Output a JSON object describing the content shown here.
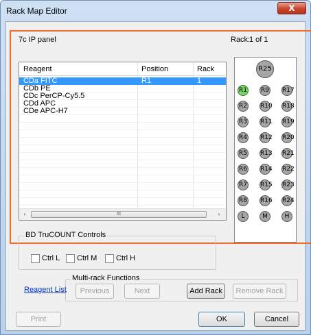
{
  "window": {
    "title": "Rack Map Editor",
    "close_glyph": "X"
  },
  "panel": {
    "title": "7c IP panel",
    "rack_label": "Rack:",
    "rack_value": "1 of 1"
  },
  "grid": {
    "columns": [
      "Reagent",
      "Position",
      "Rack"
    ],
    "rows": [
      {
        "reagent": "CDa FITC",
        "position": "R1",
        "rack": "1",
        "selected": true
      },
      {
        "reagent": "CDb PE",
        "position": "",
        "rack": "",
        "selected": false
      },
      {
        "reagent": "CDc PerCP-Cy5.5",
        "position": "",
        "rack": "",
        "selected": false
      },
      {
        "reagent": "CDd APC",
        "position": "",
        "rack": "",
        "selected": false
      },
      {
        "reagent": "CDe APC-H7",
        "position": "",
        "rack": "",
        "selected": false
      }
    ],
    "scroll_left": "‹",
    "scroll_right": "›",
    "scroll_grip": "III"
  },
  "rack_map": {
    "top_tube": "R25",
    "tube_rows": [
      [
        "R1",
        "R9",
        "R17"
      ],
      [
        "R2",
        "R10",
        "R18"
      ],
      [
        "R3",
        "R11",
        "R19"
      ],
      [
        "R4",
        "R12",
        "R20"
      ],
      [
        "R5",
        "R13",
        "R21"
      ],
      [
        "R6",
        "R14",
        "R22"
      ],
      [
        "R7",
        "R15",
        "R23"
      ],
      [
        "R8",
        "R16",
        "R24"
      ],
      [
        "L",
        "M",
        "H"
      ]
    ],
    "active_tube": "R1",
    "colors": {
      "tube": "#a6a6a6",
      "active": "#7ed46a",
      "highlight": "#ee6a26"
    }
  },
  "trucount": {
    "title": "BD TruCOUNT Controls",
    "items": [
      {
        "label": "Ctrl L",
        "checked": false
      },
      {
        "label": "Ctrl M",
        "checked": false
      },
      {
        "label": "Ctrl H",
        "checked": false
      }
    ]
  },
  "multirack": {
    "title": "Multi-rack Functions",
    "previous": "Previous",
    "next": "Next",
    "add_rack": "Add Rack",
    "remove_rack": "Remove Rack"
  },
  "links": {
    "reagent_list": "Reagent List"
  },
  "footer": {
    "print": "Print",
    "ok": "OK",
    "cancel": "Cancel"
  }
}
